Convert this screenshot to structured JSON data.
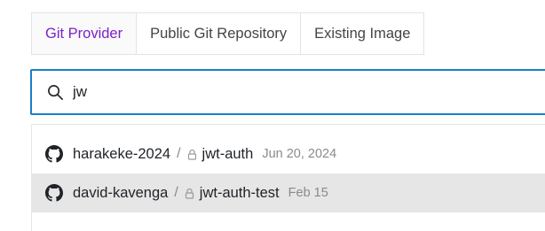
{
  "tabs": [
    {
      "label": "Git Provider",
      "active": true
    },
    {
      "label": "Public Git Repository",
      "active": false
    },
    {
      "label": "Existing Image",
      "active": false
    }
  ],
  "search": {
    "value": "jw",
    "icon": "search-icon"
  },
  "results": [
    {
      "owner": "harakeke-2024",
      "separator": "/",
      "repo": "jwt-auth",
      "date": "Jun 20, 2024",
      "icon": "github-icon",
      "private": true
    },
    {
      "owner": "david-kavenga",
      "separator": "/",
      "repo": "jwt-auth-test",
      "date": "Feb 15",
      "icon": "github-icon",
      "private": true
    }
  ],
  "colors": {
    "accent": "#7a22c9",
    "focus_border": "#1a7fc6",
    "hover_row": "#e6e6e6",
    "muted_text": "#8a8a8a"
  }
}
